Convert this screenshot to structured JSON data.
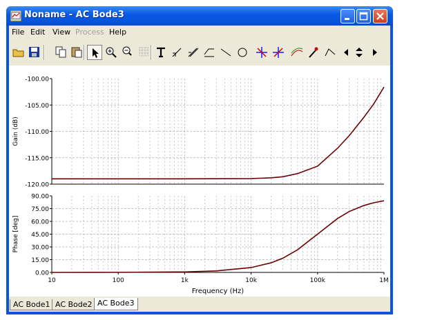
{
  "window": {
    "title": "Noname - AC Bode3"
  },
  "menu": [
    "File",
    "Edit",
    "View",
    "Process",
    "Help"
  ],
  "menu_disabled": [
    "Process"
  ],
  "toolbar": [
    {
      "name": "open-folder-icon"
    },
    {
      "name": "save-icon"
    },
    {
      "name": "copy-icon"
    },
    {
      "name": "paste-icon"
    },
    {
      "name": "select-arrow-icon",
      "pressed": true
    },
    {
      "name": "zoom-in-icon"
    },
    {
      "name": "zoom-100-icon"
    },
    {
      "name": "grid-icon"
    },
    {
      "name": "text-tool-icon"
    },
    {
      "name": "slope-tool-icon"
    },
    {
      "name": "slope-tool-2-icon"
    },
    {
      "name": "slope-tool-3-icon"
    },
    {
      "name": "line-tool-icon"
    },
    {
      "name": "circle-tool-icon"
    },
    {
      "name": "cursor-a-icon"
    },
    {
      "name": "cursor-b-icon"
    },
    {
      "name": "curve-tool-icon"
    },
    {
      "name": "probe-tool-icon"
    },
    {
      "name": "polyline-tool-icon"
    },
    {
      "name": "scroll-left-icon"
    },
    {
      "name": "scroll-up-down-icon"
    },
    {
      "name": "scroll-right-icon"
    }
  ],
  "tabs": [
    "AC Bode1",
    "AC Bode2",
    "AC Bode3"
  ],
  "active_tab": 2,
  "colors": {
    "trace": "#6b0000",
    "grid": "#b0b0b0",
    "axis": "#000000"
  },
  "chart_data": [
    {
      "type": "line",
      "ylabel": "Gain (dB)",
      "xscale": "log",
      "xlim": [
        10,
        1000000
      ],
      "ylim": [
        -120,
        -100
      ],
      "yticks": [
        "-100.00",
        "-105.00",
        "-110.00",
        "-115.00",
        "-120.00"
      ],
      "ytick_values": [
        -100,
        -105,
        -110,
        -115,
        -120
      ],
      "grid": true,
      "x": [
        10,
        100,
        1000,
        10000,
        20000,
        30000,
        50000,
        100000,
        200000,
        300000,
        500000,
        700000,
        1000000
      ],
      "y": [
        -119.0,
        -119.0,
        -119.0,
        -118.95,
        -118.8,
        -118.6,
        -118.0,
        -116.6,
        -113.2,
        -110.8,
        -107.3,
        -104.8,
        -101.6
      ]
    },
    {
      "type": "line",
      "ylabel": "Phase [deg]",
      "xlabel": "Frequency (Hz)",
      "xscale": "log",
      "xlim": [
        10,
        1000000
      ],
      "ylim": [
        0,
        90
      ],
      "yticks": [
        "90.00",
        "75.00",
        "60.00",
        "45.00",
        "30.00",
        "15.00",
        "0.00"
      ],
      "ytick_values": [
        90,
        75,
        60,
        45,
        30,
        15,
        0
      ],
      "xticks": [
        "10",
        "100",
        "1k",
        "10k",
        "100k",
        "1M"
      ],
      "xtick_values": [
        10,
        100,
        1000,
        10000,
        100000,
        1000000
      ],
      "grid": true,
      "x": [
        10,
        100,
        1000,
        3000,
        10000,
        20000,
        30000,
        50000,
        100000,
        200000,
        300000,
        500000,
        700000,
        1000000
      ],
      "y": [
        0,
        0.1,
        0.6,
        1.8,
        5.7,
        11.3,
        16.7,
        26.6,
        45.0,
        63.4,
        71.6,
        78.7,
        81.9,
        84.3
      ]
    }
  ]
}
